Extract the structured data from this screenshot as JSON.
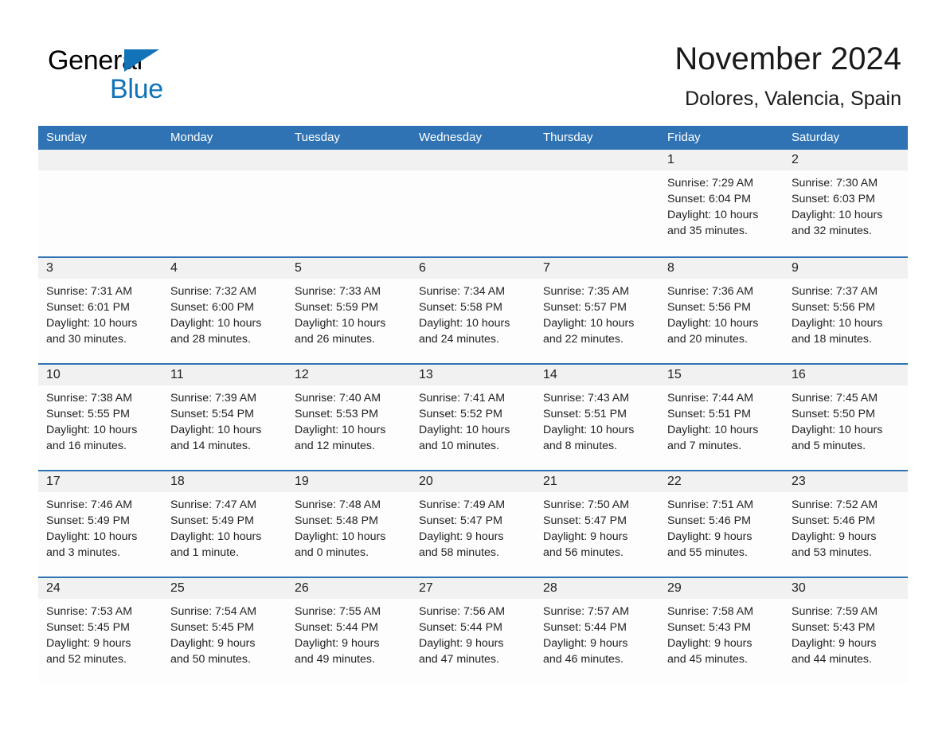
{
  "brand": {
    "name_part1": "General",
    "name_part2": "Blue",
    "triangle_color": "#1273b8"
  },
  "header": {
    "title": "November 2024",
    "location": "Dolores, Valencia, Spain"
  },
  "theme": {
    "header_blue": "#3073b4",
    "row_divider_blue": "#3073b4",
    "daynum_band": "#f1f1f1",
    "cell_background": "#fdfdfd",
    "text_color": "#222222"
  },
  "weekdays": [
    "Sunday",
    "Monday",
    "Tuesday",
    "Wednesday",
    "Thursday",
    "Friday",
    "Saturday"
  ],
  "weeks": [
    [
      {
        "day": "",
        "lines": []
      },
      {
        "day": "",
        "lines": []
      },
      {
        "day": "",
        "lines": []
      },
      {
        "day": "",
        "lines": []
      },
      {
        "day": "",
        "lines": []
      },
      {
        "day": "1",
        "lines": [
          "Sunrise: 7:29 AM",
          "Sunset: 6:04 PM",
          "Daylight: 10 hours",
          "and 35 minutes."
        ]
      },
      {
        "day": "2",
        "lines": [
          "Sunrise: 7:30 AM",
          "Sunset: 6:03 PM",
          "Daylight: 10 hours",
          "and 32 minutes."
        ]
      }
    ],
    [
      {
        "day": "3",
        "lines": [
          "Sunrise: 7:31 AM",
          "Sunset: 6:01 PM",
          "Daylight: 10 hours",
          "and 30 minutes."
        ]
      },
      {
        "day": "4",
        "lines": [
          "Sunrise: 7:32 AM",
          "Sunset: 6:00 PM",
          "Daylight: 10 hours",
          "and 28 minutes."
        ]
      },
      {
        "day": "5",
        "lines": [
          "Sunrise: 7:33 AM",
          "Sunset: 5:59 PM",
          "Daylight: 10 hours",
          "and 26 minutes."
        ]
      },
      {
        "day": "6",
        "lines": [
          "Sunrise: 7:34 AM",
          "Sunset: 5:58 PM",
          "Daylight: 10 hours",
          "and 24 minutes."
        ]
      },
      {
        "day": "7",
        "lines": [
          "Sunrise: 7:35 AM",
          "Sunset: 5:57 PM",
          "Daylight: 10 hours",
          "and 22 minutes."
        ]
      },
      {
        "day": "8",
        "lines": [
          "Sunrise: 7:36 AM",
          "Sunset: 5:56 PM",
          "Daylight: 10 hours",
          "and 20 minutes."
        ]
      },
      {
        "day": "9",
        "lines": [
          "Sunrise: 7:37 AM",
          "Sunset: 5:56 PM",
          "Daylight: 10 hours",
          "and 18 minutes."
        ]
      }
    ],
    [
      {
        "day": "10",
        "lines": [
          "Sunrise: 7:38 AM",
          "Sunset: 5:55 PM",
          "Daylight: 10 hours",
          "and 16 minutes."
        ]
      },
      {
        "day": "11",
        "lines": [
          "Sunrise: 7:39 AM",
          "Sunset: 5:54 PM",
          "Daylight: 10 hours",
          "and 14 minutes."
        ]
      },
      {
        "day": "12",
        "lines": [
          "Sunrise: 7:40 AM",
          "Sunset: 5:53 PM",
          "Daylight: 10 hours",
          "and 12 minutes."
        ]
      },
      {
        "day": "13",
        "lines": [
          "Sunrise: 7:41 AM",
          "Sunset: 5:52 PM",
          "Daylight: 10 hours",
          "and 10 minutes."
        ]
      },
      {
        "day": "14",
        "lines": [
          "Sunrise: 7:43 AM",
          "Sunset: 5:51 PM",
          "Daylight: 10 hours",
          "and 8 minutes."
        ]
      },
      {
        "day": "15",
        "lines": [
          "Sunrise: 7:44 AM",
          "Sunset: 5:51 PM",
          "Daylight: 10 hours",
          "and 7 minutes."
        ]
      },
      {
        "day": "16",
        "lines": [
          "Sunrise: 7:45 AM",
          "Sunset: 5:50 PM",
          "Daylight: 10 hours",
          "and 5 minutes."
        ]
      }
    ],
    [
      {
        "day": "17",
        "lines": [
          "Sunrise: 7:46 AM",
          "Sunset: 5:49 PM",
          "Daylight: 10 hours",
          "and 3 minutes."
        ]
      },
      {
        "day": "18",
        "lines": [
          "Sunrise: 7:47 AM",
          "Sunset: 5:49 PM",
          "Daylight: 10 hours",
          "and 1 minute."
        ]
      },
      {
        "day": "19",
        "lines": [
          "Sunrise: 7:48 AM",
          "Sunset: 5:48 PM",
          "Daylight: 10 hours",
          "and 0 minutes."
        ]
      },
      {
        "day": "20",
        "lines": [
          "Sunrise: 7:49 AM",
          "Sunset: 5:47 PM",
          "Daylight: 9 hours",
          "and 58 minutes."
        ]
      },
      {
        "day": "21",
        "lines": [
          "Sunrise: 7:50 AM",
          "Sunset: 5:47 PM",
          "Daylight: 9 hours",
          "and 56 minutes."
        ]
      },
      {
        "day": "22",
        "lines": [
          "Sunrise: 7:51 AM",
          "Sunset: 5:46 PM",
          "Daylight: 9 hours",
          "and 55 minutes."
        ]
      },
      {
        "day": "23",
        "lines": [
          "Sunrise: 7:52 AM",
          "Sunset: 5:46 PM",
          "Daylight: 9 hours",
          "and 53 minutes."
        ]
      }
    ],
    [
      {
        "day": "24",
        "lines": [
          "Sunrise: 7:53 AM",
          "Sunset: 5:45 PM",
          "Daylight: 9 hours",
          "and 52 minutes."
        ]
      },
      {
        "day": "25",
        "lines": [
          "Sunrise: 7:54 AM",
          "Sunset: 5:45 PM",
          "Daylight: 9 hours",
          "and 50 minutes."
        ]
      },
      {
        "day": "26",
        "lines": [
          "Sunrise: 7:55 AM",
          "Sunset: 5:44 PM",
          "Daylight: 9 hours",
          "and 49 minutes."
        ]
      },
      {
        "day": "27",
        "lines": [
          "Sunrise: 7:56 AM",
          "Sunset: 5:44 PM",
          "Daylight: 9 hours",
          "and 47 minutes."
        ]
      },
      {
        "day": "28",
        "lines": [
          "Sunrise: 7:57 AM",
          "Sunset: 5:44 PM",
          "Daylight: 9 hours",
          "and 46 minutes."
        ]
      },
      {
        "day": "29",
        "lines": [
          "Sunrise: 7:58 AM",
          "Sunset: 5:43 PM",
          "Daylight: 9 hours",
          "and 45 minutes."
        ]
      },
      {
        "day": "30",
        "lines": [
          "Sunrise: 7:59 AM",
          "Sunset: 5:43 PM",
          "Daylight: 9 hours",
          "and 44 minutes."
        ]
      }
    ]
  ]
}
